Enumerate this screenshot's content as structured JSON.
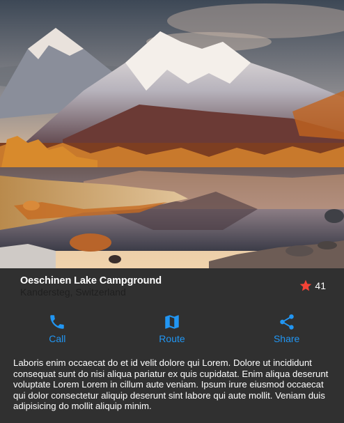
{
  "header_image": {
    "description_icon": "landscape-photo"
  },
  "title_section": {
    "title": "Oeschinen Lake Campground",
    "subtitle": "Kandersteg, Switzerland",
    "favorite_icon": "star-icon",
    "favorite_count": "41"
  },
  "buttons": [
    {
      "label": "Call",
      "icon": "phone-icon"
    },
    {
      "label": "Route",
      "icon": "map-icon"
    },
    {
      "label": "Share",
      "icon": "share-icon"
    }
  ],
  "body_text": "Laboris enim occaecat do et id velit dolore qui Lorem. Dolore ut incididunt consequat sunt do nisi aliqua pariatur ex quis cupidatat. Enim aliqua deserunt voluptate Lorem Lorem in cillum aute veniam. Ipsum irure eiusmod occaecat qui dolor consectetur aliquip deserunt sint labore qui aute mollit. Veniam duis adipisicing do mollit aliquip minim.",
  "colors": {
    "background": "#303030",
    "accent": "#2196F3",
    "star": "#F44336"
  }
}
